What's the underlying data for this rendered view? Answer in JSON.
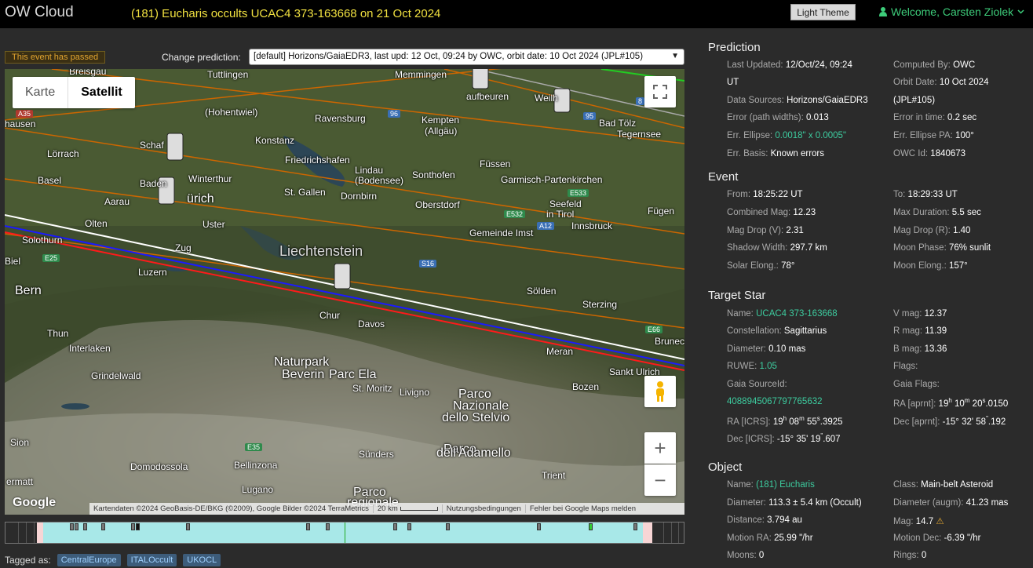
{
  "header": {
    "brand": "OW Cloud",
    "event_title": "(181) Eucharis occults UCAC4 373-163668 on 21 Oct 2024",
    "theme_button": "Light Theme",
    "welcome": "Welcome, Carsten Ziolek"
  },
  "toolbar": {
    "passed_badge": "This event has passed",
    "change_label": "Change prediction:",
    "prediction_selected": "[default] Horizons/GaiaEDR3, last upd: 12 Oct, 09:24 by OWC, orbit date: 10 Oct 2024 (JPL#105)"
  },
  "map": {
    "type_map": "Karte",
    "type_satellite": "Satellit",
    "google": "Google",
    "attribution": "Kartendaten ©2024 GeoBasis-DE/BKG (©2009), Google Bilder ©2024 TerraMetrics",
    "scale": "20 km",
    "terms": "Nutzungsbedingungen",
    "report": "Fehler bei Google Maps melden",
    "places": {
      "breisgau": "Breisgau",
      "tuttlingen": "Tuttlingen",
      "memmingen": "Memmingen",
      "kaufbeuren": "aufbeuren",
      "hausen": "hausen",
      "hohentwiel": "(Hohentwiel)",
      "ravensburg": "Ravensburg",
      "kempten": "Kempten",
      "allgau": "(Allgäu)",
      "weilheim": "Weilh",
      "badtolz": "Bad Tölz",
      "tegernsee": "Tegernsee",
      "schaff": "Schaf",
      "konstanz": "Konstanz",
      "lorrach": "Lörrach",
      "friedrichshafen": "Friedrichshafen",
      "fussen": "Füssen",
      "lindau": "Lindau",
      "bodensee": "(Bodensee)",
      "winterthur": "Winterthur",
      "sonthofen": "Sonthofen",
      "garmisch": "Garmisch-Partenkirchen",
      "basel": "Basel",
      "baden": "Baden",
      "zurich": "ürich",
      "stgallen": "St. Gallen",
      "dornbirn": "Dornbirn",
      "aarau": "Aarau",
      "oberstdorf": "Oberstdorf",
      "seefeld": "Seefeld",
      "tirol": "in Tirol",
      "fugen": "Fügen",
      "olten": "Olten",
      "uster": "Uster",
      "imst": "Gemeinde Imst",
      "innsbruck": "Innsbruck",
      "solothurn": "Solothurn",
      "zug": "Zug",
      "liechtenstein": "Liechtenstein",
      "biel": "Biel",
      "luzern": "Luzern",
      "bern": "Bern",
      "solden": "Sölden",
      "sterzing": "Sterzing",
      "chur": "Chur",
      "davos": "Davos",
      "thun": "Thun",
      "interlaken": "Interlaken",
      "meran": "Meran",
      "bruneck": "Brunec",
      "naturpark": "Naturpark",
      "beverin": "Beverin",
      "parcela": "Parc Ela",
      "sanktulrich": "Sankt Ulrich",
      "grindelwald": "Grindelwald",
      "stmoritz": "St. Moritz",
      "livigno": "Livigno",
      "bozen": "Bozen",
      "parco1": "Parco",
      "nazionale": "Nazionale",
      "stelvio": "dello Stelvio",
      "sion": "Sion",
      "parco2": "Parco",
      "adamello": "dell'Adamello",
      "sunders": "Sünders",
      "domodossola": "Domodossola",
      "bellinzona": "Bellinzona",
      "trient": "Trient",
      "lugano": "Lugano",
      "parco3": "Parco",
      "regionale": "regionale",
      "zermatt": "ermatt"
    },
    "roads": {
      "a35": "A35",
      "r96": "96",
      "r95": "95",
      "e532": "E532",
      "e533": "E533",
      "a12": "A12",
      "e25": "E25",
      "s16": "S16",
      "e66": "E66",
      "e35": "E35",
      "r8": "8"
    }
  },
  "tags": {
    "label": "Tagged as:",
    "items": [
      "CentralEurope",
      "ITALOccult",
      "UKOCL"
    ]
  },
  "prediction": {
    "title": "Prediction",
    "last_updated_label": "Last Updated:",
    "last_updated": "12/Oct/24, 09:24",
    "last_updated_tz": "UT",
    "computed_by_label": "Computed By:",
    "computed_by": "OWC",
    "orbit_date_label": "Orbit Date:",
    "orbit_date": "10 Oct 2024",
    "orbit_ref": "(JPL#105)",
    "data_sources_label": "Data Sources:",
    "data_sources": "Horizons/GaiaEDR3",
    "error_path_label": "Error (path widths):",
    "error_path": "0.013",
    "error_time_label": "Error in time:",
    "error_time": "0.2 sec",
    "err_ellipse_label": "Err. Ellipse:",
    "err_ellipse": "0.0018\" x 0.0005\"",
    "err_ellipse_pa_label": "Err. Ellipse PA:",
    "err_ellipse_pa": "100°",
    "err_basis_label": "Err. Basis:",
    "err_basis": "Known errors",
    "owc_id_label": "OWC Id:",
    "owc_id": "1840673"
  },
  "event": {
    "title": "Event",
    "from_label": "From:",
    "from": "18:25:22 UT",
    "to_label": "To:",
    "to": "18:29:33 UT",
    "combined_mag_label": "Combined Mag:",
    "combined_mag": "12.23",
    "max_duration_label": "Max Duration:",
    "max_duration": "5.5 sec",
    "mag_drop_v_label": "Mag Drop (V):",
    "mag_drop_v": "2.31",
    "mag_drop_r_label": "Mag Drop (R):",
    "mag_drop_r": "1.40",
    "shadow_width_label": "Shadow Width:",
    "shadow_width": "297.7 km",
    "moon_phase_label": "Moon Phase:",
    "moon_phase": "76% sunlit",
    "solar_elong_label": "Solar Elong.:",
    "solar_elong": "78°",
    "moon_elong_label": "Moon Elong.:",
    "moon_elong": "157°"
  },
  "target_star": {
    "title": "Target Star",
    "name_label": "Name:",
    "name": "UCAC4 373-163668",
    "vmag_label": "V mag:",
    "vmag": "12.37",
    "constellation_label": "Constellation:",
    "constellation": "Sagittarius",
    "rmag_label": "R mag:",
    "rmag": "11.39",
    "diameter_label": "Diameter:",
    "diameter": "0.10 mas",
    "bmag_label": "B mag:",
    "bmag": "13.36",
    "ruwe_label": "RUWE:",
    "ruwe": "1.05",
    "flags_label": "Flags:",
    "gaia_source_label": "Gaia SourceId:",
    "gaia_source": "4088945067797765632",
    "gaia_flags_label": "Gaia Flags:",
    "ra_aprnt_label": "RA [aprnt]:",
    "ra_aprnt_h": "19",
    "ra_aprnt_m": "10",
    "ra_aprnt_s": "20",
    "ra_aprnt_frac": "0150",
    "ra_icrs_label": "RA [ICRS]:",
    "ra_icrs_h": "19",
    "ra_icrs_m": "08",
    "ra_icrs_s": "55",
    "ra_icrs_frac": "3925",
    "dec_aprnt_label": "Dec [aprnt]:",
    "dec_aprnt_d": "-15°",
    "dec_aprnt_m": "32",
    "dec_aprnt_s": "58",
    "dec_aprnt_frac": "192",
    "dec_icrs_label": "Dec [ICRS]:",
    "dec_icrs_d": "-15°",
    "dec_icrs_m": "35",
    "dec_icrs_s": "19",
    "dec_icrs_frac": "607"
  },
  "object": {
    "title": "Object",
    "name_label": "Name:",
    "name": "(181) Eucharis",
    "class_label": "Class:",
    "class": "Main-belt Asteroid",
    "diameter_label": "Diameter:",
    "diameter": "113.3 ± 5.4 km",
    "diameter_src": "(Occult)",
    "diameter_augm_label": "Diameter (augm):",
    "diameter_augm": "41.23 mas",
    "distance_label": "Distance:",
    "distance": "3.794 au",
    "mag_label": "Mag:",
    "mag": "14.7",
    "motion_ra_label": "Motion RA:",
    "motion_ra": "25.99 \"/hr",
    "motion_dec_label": "Motion Dec:",
    "motion_dec": "-6.39 \"/hr",
    "moons_label": "Moons:",
    "moons": "0",
    "rings_label": "Rings:",
    "rings": "0"
  },
  "colors": {
    "accent": "#3dcc9f",
    "title_yellow": "#f0e040",
    "path_center": "#ffffff",
    "path_north": "#1a1aff",
    "path_south": "#ff1a1a",
    "path_sigma": "#cc6600"
  }
}
